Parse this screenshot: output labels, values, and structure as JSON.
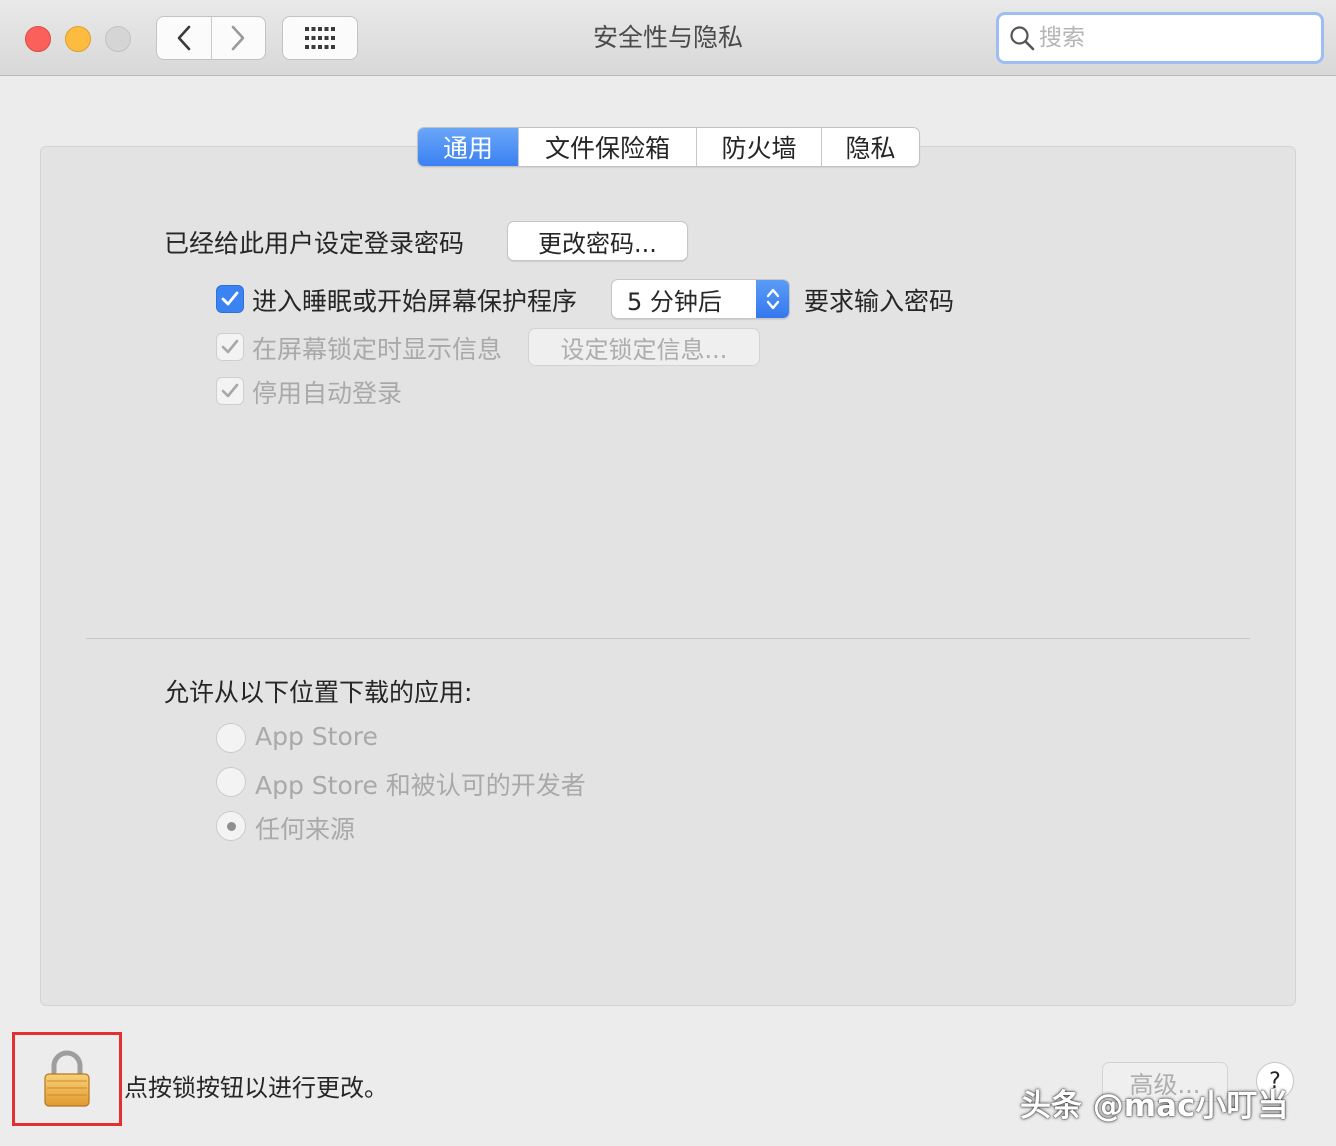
{
  "window": {
    "title": "安全性与隐私",
    "search_placeholder": "搜索"
  },
  "tabs": [
    {
      "label": "通用",
      "active": true
    },
    {
      "label": "文件保险箱",
      "active": false
    },
    {
      "label": "防火墙",
      "active": false
    },
    {
      "label": "隐私",
      "active": false
    }
  ],
  "general": {
    "password_set_label": "已经给此用户设定登录密码",
    "change_password_button": "更改密码...",
    "require_password": {
      "checked": true,
      "label_before": "进入睡眠或开始屏幕保护程序",
      "delay_value": "5 分钟后",
      "label_after": "要求输入密码"
    },
    "show_message": {
      "checked": true,
      "enabled": false,
      "label": "在屏幕锁定时显示信息",
      "button": "设定锁定信息..."
    },
    "disable_autologin": {
      "checked": true,
      "enabled": false,
      "label": "停用自动登录"
    },
    "allow_apps_label": "允许从以下位置下载的应用:",
    "app_sources": [
      {
        "label": "App Store",
        "selected": false
      },
      {
        "label": "App Store 和被认可的开发者",
        "selected": false
      },
      {
        "label": "任何来源",
        "selected": true
      }
    ]
  },
  "footer": {
    "lock_hint": "点按锁按钮以进行更改。",
    "advanced_button": "高级...",
    "help_button": "?",
    "watermark": "头条 @mac小叮当"
  },
  "colors": {
    "accent": "#3b82f3",
    "lock_highlight": "#e23030",
    "traffic_close": "#fc605b",
    "traffic_minimize": "#fdbc40"
  },
  "icons": {
    "back": "chevron-left-icon",
    "forward": "chevron-right-icon",
    "grid": "grid-icon",
    "search": "search-icon",
    "lock": "lock-icon"
  }
}
